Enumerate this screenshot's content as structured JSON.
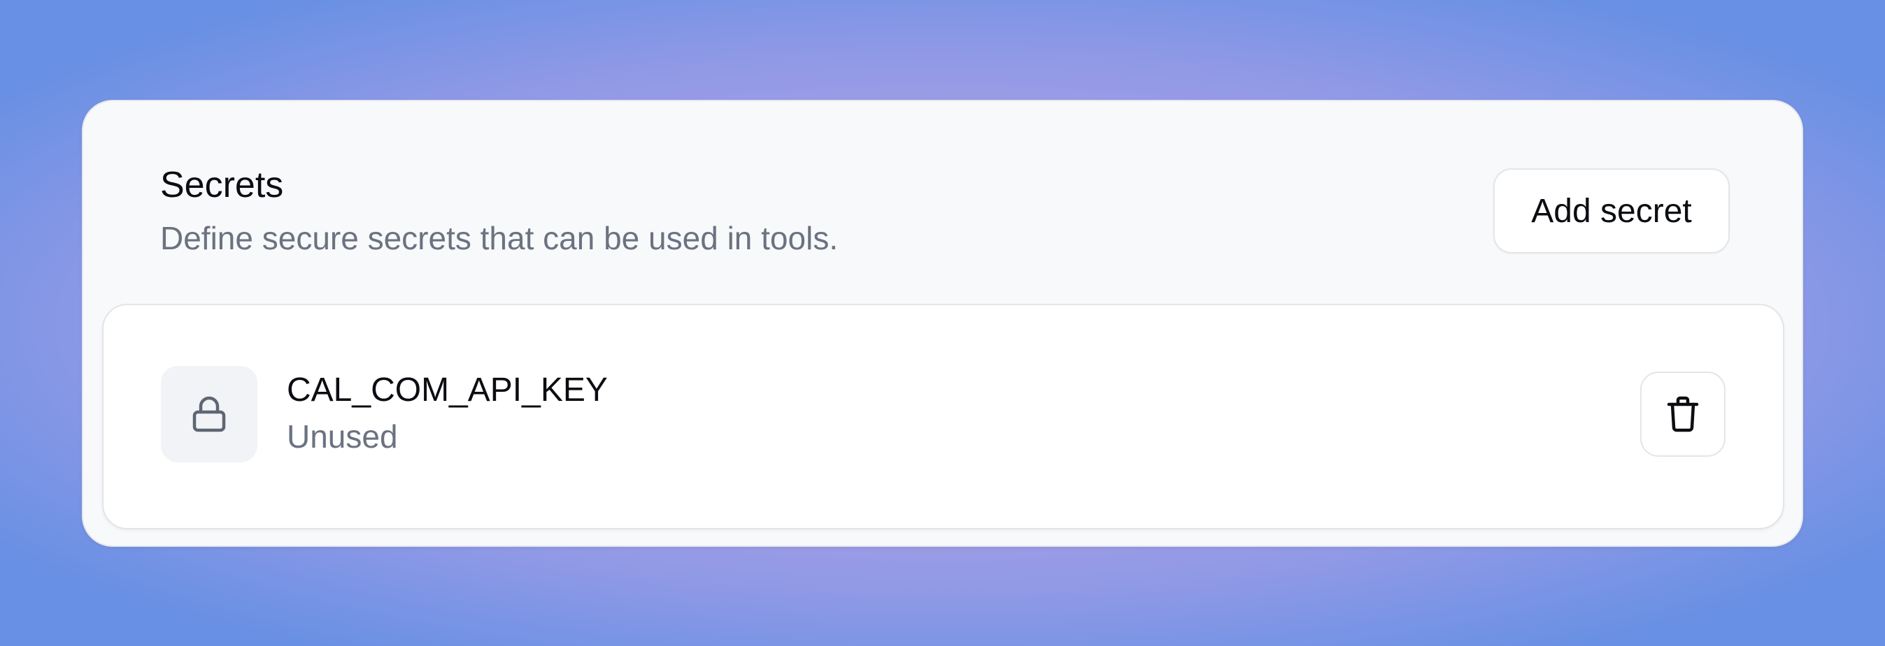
{
  "secrets_panel": {
    "title": "Secrets",
    "subtitle": "Define secure secrets that can be used in tools.",
    "add_button_label": "Add secret"
  },
  "secrets": [
    {
      "name": "CAL_COM_API_KEY",
      "status": "Unused",
      "icon": "lock-icon",
      "action_icon": "trash-icon"
    }
  ],
  "colors": {
    "background_outer": "#6890e4",
    "background_glow": "#c3a2e6",
    "panel": "#f8f9fb",
    "card": "#ffffff",
    "text_primary": "#0b0d12",
    "text_secondary": "#6b7280"
  }
}
